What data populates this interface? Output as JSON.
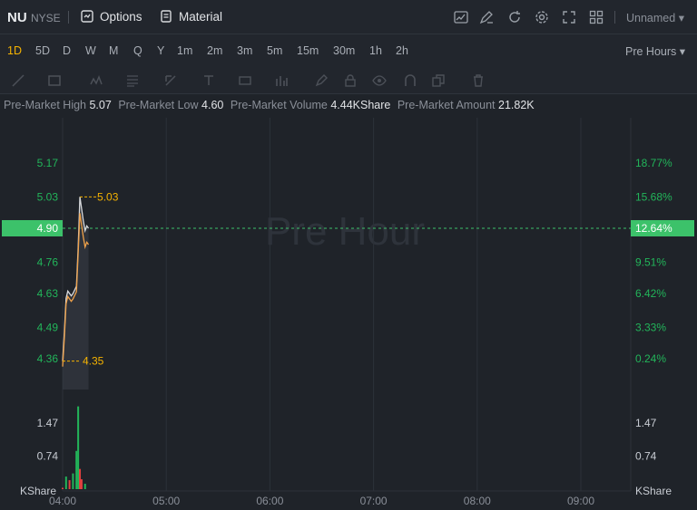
{
  "header": {
    "symbol": "NU",
    "exchange": "NYSE",
    "options_label": "Options",
    "material_label": "Material",
    "layout_name": "Unnamed"
  },
  "timeframes": [
    "1D",
    "5D",
    "D",
    "W",
    "M",
    "Q",
    "Y",
    "1m",
    "2m",
    "3m",
    "5m",
    "15m",
    "30m",
    "1h",
    "2h"
  ],
  "active_timeframe": "1D",
  "session_select": "Pre Hours",
  "stats": [
    {
      "key": "Pre-Market High",
      "value": "5.07"
    },
    {
      "key": "Pre-Market Low",
      "value": "4.60"
    },
    {
      "key": "Pre-Market Volume",
      "value": "4.44KShare"
    },
    {
      "key": "Pre-Market Amount",
      "value": "21.82K"
    }
  ],
  "watermark": "Pre Hour",
  "colors": {
    "up": "#22b55a",
    "down": "#e2403f",
    "accent": "#f5b301",
    "price_line": "#f0a24a",
    "current": "#3cc26a"
  },
  "chart_data": {
    "type": "line",
    "price_axis_left": [
      "5.17",
      "5.03",
      "4.90",
      "4.76",
      "4.63",
      "4.49",
      "4.36"
    ],
    "price_axis_right": [
      "18.77%",
      "15.68%",
      "12.64%",
      "9.51%",
      "6.42%",
      "3.33%",
      "0.24%"
    ],
    "current_price": "4.90",
    "current_change": "12.64%",
    "high_marker": "5.03",
    "low_marker": "4.35",
    "volume_axis": [
      "1.47",
      "0.74"
    ],
    "volume_unit": "KShare",
    "x_ticks": [
      "04:00",
      "05:00",
      "06:00",
      "07:00",
      "08:00",
      "09:00"
    ],
    "price_series": [
      {
        "t": "04:00",
        "v": 4.35
      },
      {
        "t": "04:01",
        "v": 4.47
      },
      {
        "t": "04:02",
        "v": 4.61
      },
      {
        "t": "04:03",
        "v": 4.64
      },
      {
        "t": "04:05",
        "v": 4.62
      },
      {
        "t": "04:06",
        "v": 4.63
      },
      {
        "t": "04:08",
        "v": 4.66
      },
      {
        "t": "04:09",
        "v": 4.82
      },
      {
        "t": "04:10",
        "v": 5.03
      },
      {
        "t": "04:12",
        "v": 4.93
      },
      {
        "t": "04:13",
        "v": 4.89
      },
      {
        "t": "04:14",
        "v": 4.91
      },
      {
        "t": "04:15",
        "v": 4.9
      }
    ],
    "volume_series": [
      {
        "t": "04:00",
        "v": 0.03,
        "d": "down"
      },
      {
        "t": "04:02",
        "v": 0.28,
        "d": "up"
      },
      {
        "t": "04:04",
        "v": 0.2,
        "d": "down"
      },
      {
        "t": "04:06",
        "v": 0.35,
        "d": "up"
      },
      {
        "t": "04:08",
        "v": 0.85,
        "d": "up"
      },
      {
        "t": "04:09",
        "v": 1.84,
        "d": "up"
      },
      {
        "t": "04:10",
        "v": 0.45,
        "d": "down"
      },
      {
        "t": "04:11",
        "v": 0.22,
        "d": "down"
      },
      {
        "t": "04:13",
        "v": 0.12,
        "d": "up"
      }
    ]
  }
}
